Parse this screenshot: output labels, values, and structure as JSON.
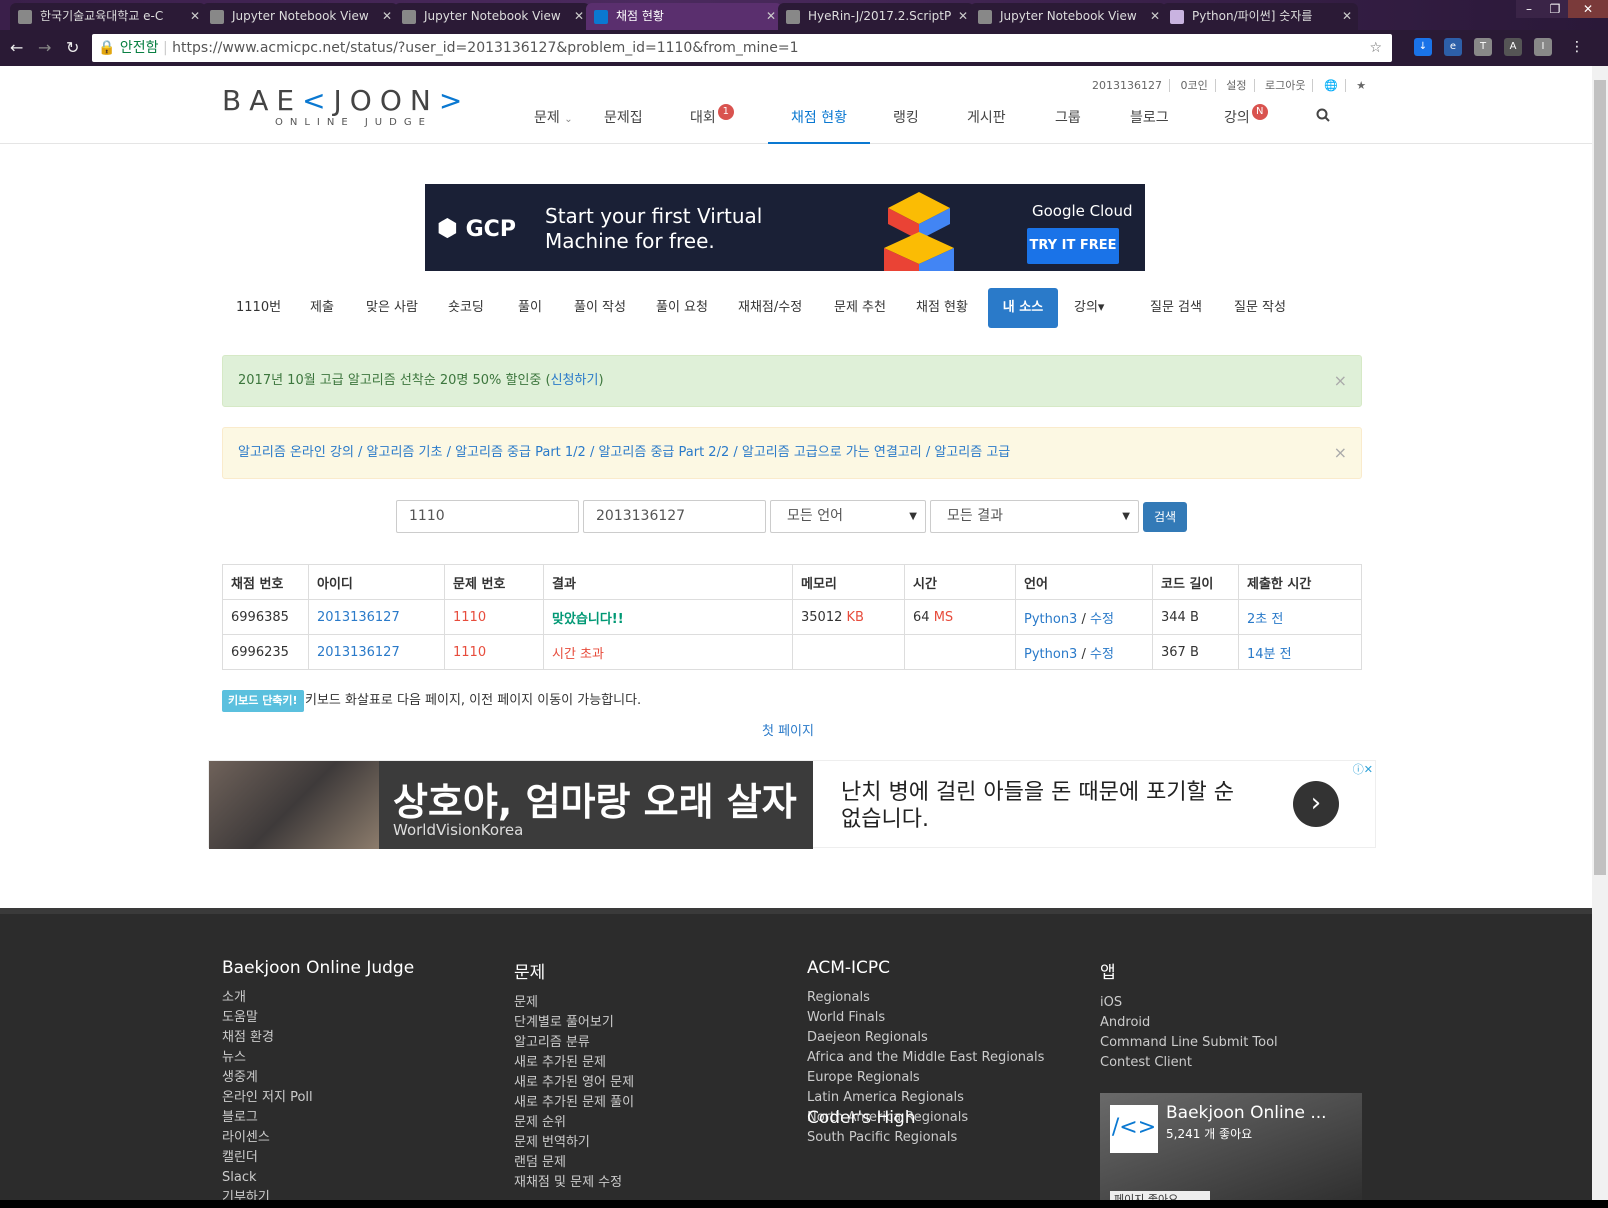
{
  "browser": {
    "tabs": [
      {
        "title": "한국기술교육대학교 e-C"
      },
      {
        "title": "Jupyter Notebook View"
      },
      {
        "title": "Jupyter Notebook View"
      },
      {
        "title": "채점 현황"
      },
      {
        "title": "HyeRin-J/2017.2.ScriptP"
      },
      {
        "title": "Jupyter Notebook View"
      },
      {
        "title": "Python/파이썬] 숫자를"
      }
    ],
    "window_buttons": [
      "–",
      "❐",
      "✕"
    ],
    "secure_label": "안전함",
    "url": "https://www.acmicpc.net/status/?user_id=2013136127&problem_id=1110&from_mine=1"
  },
  "header": {
    "logo_main_a": "BAE",
    "logo_main_b": "<",
    "logo_main_c": "JOON",
    "logo_main_d": ">",
    "logo_sub": "ONLINE JUDGE",
    "meta": [
      "2013136127",
      "0코인",
      "설정",
      "로그아웃",
      "🌐",
      "★"
    ],
    "nav": [
      {
        "label": "문제",
        "suffix": "⌄"
      },
      {
        "label": "문제집"
      },
      {
        "label": "대회",
        "badge": "1"
      },
      {
        "label": "채점 현황"
      },
      {
        "label": "랭킹"
      },
      {
        "label": "게시판"
      },
      {
        "label": "그룹"
      },
      {
        "label": "블로그"
      },
      {
        "label": "강의",
        "badge": "N"
      }
    ],
    "search_icon": "search-icon"
  },
  "gcp_ad": {
    "logo": "GCP",
    "headline": "Start your first Virtual Machine for free.",
    "brand": "Google Cloud",
    "cta": "TRY IT FREE"
  },
  "subnav": [
    "1110번",
    "제출",
    "맞은 사람",
    "숏코딩",
    "풀이",
    "풀이 작성",
    "풀이 요청",
    "재채점/수정",
    "문제 추천",
    "채점 현황",
    "내 소스",
    "강의▾",
    "질문 검색",
    "질문 작성"
  ],
  "alerts": {
    "promo_text": "2017년 10월 고급 알고리즘 선착순 20명 50% 할인중 (",
    "promo_link": "신청하기",
    "promo_end": ")",
    "courses": "알고리즘 온라인 강의 / 알고리즘 기초 / 알고리즘 중급 Part 1/2 / 알고리즘 중급 Part 2/2 / 알고리즘 고급으로 가는 연결고리 / 알고리즘 고급",
    "close": "×"
  },
  "search": {
    "problem_id": "1110",
    "user_id": "2013136127",
    "language": "모든 언어",
    "result": "모든 결과",
    "button": "검색"
  },
  "table": {
    "headers": [
      "채점 번호",
      "아이디",
      "문제 번호",
      "결과",
      "메모리",
      "시간",
      "언어",
      "코드 길이",
      "제출한 시간"
    ],
    "rows": [
      {
        "id": "6996385",
        "user": "2013136127",
        "problem": "1110",
        "result": "맞았습니다!!",
        "memory": "35012",
        "memory_unit": "KB",
        "time": "64",
        "time_unit": "MS",
        "lang": "Python3",
        "edit": "수정",
        "length": "344 B",
        "submitted": "2초 전"
      },
      {
        "id": "6996235",
        "user": "2013136127",
        "problem": "1110",
        "result": "시간 초과",
        "memory": "",
        "memory_unit": "",
        "time": "",
        "time_unit": "",
        "lang": "Python3",
        "edit": "수정",
        "length": "367 B",
        "submitted": "14분 전"
      }
    ]
  },
  "hint": {
    "badge": "키보드 단축키!",
    "text": "키보드 화살표로 다음 페이지, 이전 페이지 이동이 가능합니다.",
    "first_page": "첫 페이지"
  },
  "wv_ad": {
    "headline": "상호야, 엄마랑 오래 살자",
    "brand": "WorldVisionKorea",
    "body": "난치 병에 걸린 아들을 돈 때문에 포기할 순 없습니다.",
    "arrow": "›",
    "adchoices": "ⓘ✕"
  },
  "footer": {
    "columns": [
      {
        "title": "Baekjoon Online Judge",
        "items": [
          "소개",
          "도움말",
          "채점 환경",
          "뉴스",
          "생중계",
          "온라인 저지 Poll",
          "블로그",
          "라이센스",
          "캘린더",
          "Slack",
          "기부하기"
        ]
      },
      {
        "title": "문제",
        "items": [
          "문제",
          "단계별로 풀어보기",
          "알고리즘 분류",
          "새로 추가된 문제",
          "새로 추가된 영어 문제",
          "새로 추가된 문제 풀이",
          "문제 순위",
          "문제 번역하기",
          "랜덤 문제",
          "재채점 및 문제 수정"
        ]
      },
      {
        "title": "ACM-ICPC",
        "items": [
          "Regionals",
          "World Finals",
          "Daejeon Regionals",
          "Africa and the Middle East Regionals",
          "Europe Regionals",
          "Latin America Regionals",
          "North America Regionals",
          "South Pacific Regionals"
        ]
      },
      {
        "title": "앱",
        "items": [
          "iOS",
          "Android",
          "Command Line Submit Tool",
          "Contest Client"
        ]
      }
    ],
    "coders_high": "Coder's High",
    "fb_name": "Baekjoon Online ...",
    "fb_likes": "5,241 개 좋아요",
    "fb_button": "페이지 좋아요"
  }
}
